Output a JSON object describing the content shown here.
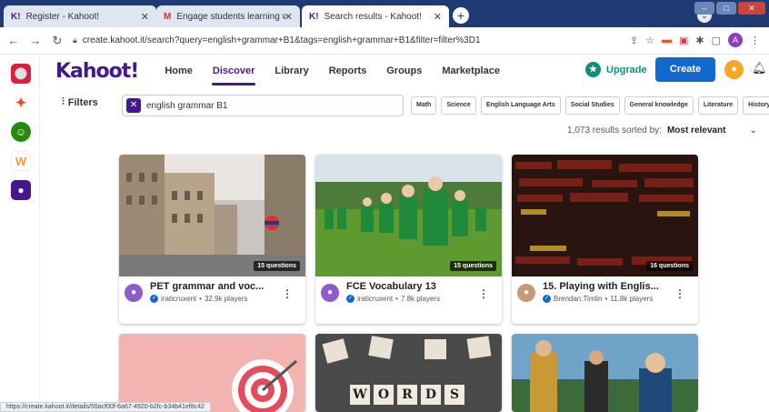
{
  "browser": {
    "tabs": [
      {
        "icon": "K!",
        "title": "Register - Kahoot!"
      },
      {
        "icon": "M",
        "title": "Engage students learning with sc"
      },
      {
        "icon": "K!",
        "title": "Search results - Kahoot!"
      }
    ],
    "new_tab": "+",
    "profile_initial": "",
    "url": "create.kahoot.it/search?query=english+grammar+B1&tags=english+grammar+B1&filter=filter%3D1",
    "avatar_initial": "A",
    "status_url": "https://create.kahoot.it/details/55acf00f-6a67-4920-b2fc-b34b41ef8c42"
  },
  "header": {
    "logo": "Kahoot!",
    "nav": [
      "Home",
      "Discover",
      "Library",
      "Reports",
      "Groups",
      "Marketplace"
    ],
    "active_nav": "Discover",
    "upgrade": "Upgrade",
    "create": "Create"
  },
  "filters": {
    "label": "Filters",
    "search_value": "english grammar B1",
    "chips": [
      "Math",
      "Science",
      "English Language Arts",
      "Social Studies",
      "General knowledge",
      "Literature",
      "History"
    ]
  },
  "results": {
    "count": "1,073 results sorted by:",
    "sort": "Most relevant"
  },
  "cards": [
    {
      "title": "PET grammar and voc...",
      "author": "iraticruxent",
      "players": "32.9k players",
      "questions": "15 questions",
      "avatar": "#8e5cc8"
    },
    {
      "title": "FCE Vocabulary 13",
      "author": "iraticruxent",
      "players": "7.8k players",
      "questions": "15 questions",
      "avatar": "#8e5cc8"
    },
    {
      "title": "15. Playing with Englis...",
      "author": "Brendan.Timlin",
      "players": "11.8k players",
      "questions": "16 questions",
      "avatar": "#c59a7a"
    }
  ],
  "bottom_thumbs": {
    "words_tiles": [
      "W",
      "O",
      "R",
      "D",
      "S"
    ]
  },
  "colors": {
    "brand": "#46178f",
    "create": "#1368ce",
    "upgrade": "#0e8f7e"
  }
}
